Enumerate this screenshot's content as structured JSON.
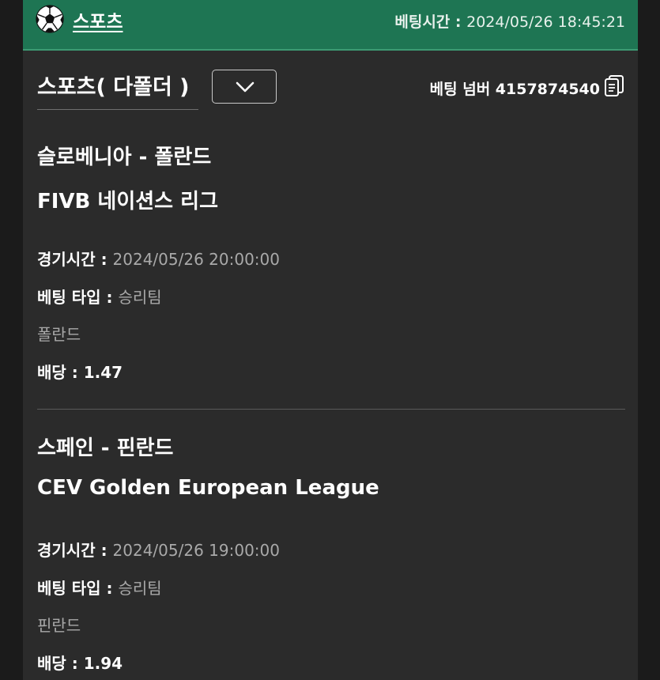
{
  "header": {
    "title": "스포츠",
    "bet_time_label": "베팅시간 : ",
    "bet_time_value": "2024/05/26 18:45:21",
    "icon": "soccer-ball-icon"
  },
  "slip": {
    "bet_type_label": "스포츠( 다폴더 )",
    "dropdown_icon": "chevron-down-icon",
    "bet_number_label": "베팅 넘버 ",
    "bet_number_value": "4157874540",
    "copy_icon": "copy-icon"
  },
  "matches": [
    {
      "teams": "슬로베니아 - 폴란드",
      "league": "FIVB 네이션스 리그",
      "time_label": "경기시간 : ",
      "time_value": "2024/05/26 20:00:00",
      "bet_type_label": "베팅 타입 : ",
      "bet_type_value": "승리팀",
      "pick": "폴란드",
      "odds_label": "배당 : ",
      "odds_value": "1.47"
    },
    {
      "teams": "스페인 - 핀란드",
      "league": "CEV Golden European League",
      "time_label": "경기시간 : ",
      "time_value": "2024/05/26 19:00:00",
      "bet_type_label": "베팅 타입 : ",
      "bet_type_value": "승리팀",
      "pick": "핀란드",
      "odds_label": "배당 : ",
      "odds_value": "1.94"
    }
  ],
  "colors": {
    "header_bg": "#1e7553",
    "panel_bg": "#2b2b2b",
    "page_bg": "#1b1b1b",
    "muted_text": "#a9a9a9"
  }
}
